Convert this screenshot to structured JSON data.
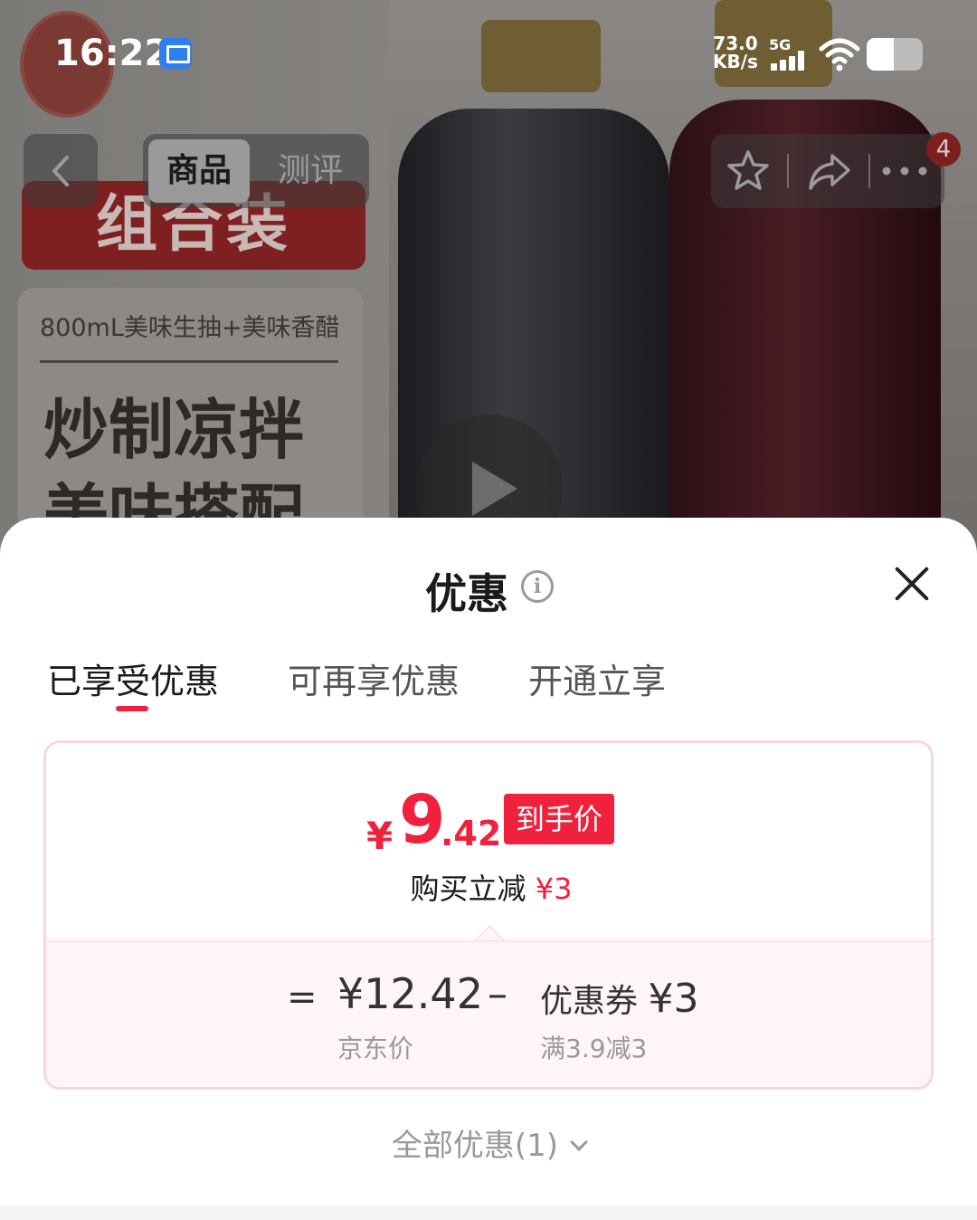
{
  "status_bar": {
    "time": "16:22",
    "net_speed_value": "73.0",
    "net_speed_unit": "KB/s",
    "network_type": "5G"
  },
  "product_image": {
    "combo_label": "组合装",
    "subtitle": "800mL美味生抽+美味香醋",
    "slogan": "炒制凉拌 美味搭配"
  },
  "top_nav": {
    "tabs": [
      {
        "label": "商品",
        "active": true
      },
      {
        "label": "测评",
        "active": false
      }
    ],
    "cart_badge": "4"
  },
  "sheet": {
    "title": "优惠",
    "tabs": [
      {
        "label": "已享受优惠",
        "active": true
      },
      {
        "label": "可再享优惠",
        "active": false
      },
      {
        "label": "开通立享",
        "active": false
      }
    ],
    "final_price": {
      "currency": "¥",
      "integer": "9",
      "decimal": ".42",
      "tag": "到手价"
    },
    "instant_reduction": {
      "label": "购买立减",
      "amount": "¥3"
    },
    "calculation": {
      "equals": "=",
      "jd_price": "¥12.42",
      "jd_price_label": "京东价",
      "minus": "–",
      "coupon_label": "优惠券",
      "coupon_amount": "¥3",
      "coupon_condition": "满3.9减3"
    },
    "all_offers_label": "全部优惠(1)"
  },
  "colors": {
    "accent": "#f0213c",
    "badge": "#7e1f1f"
  }
}
